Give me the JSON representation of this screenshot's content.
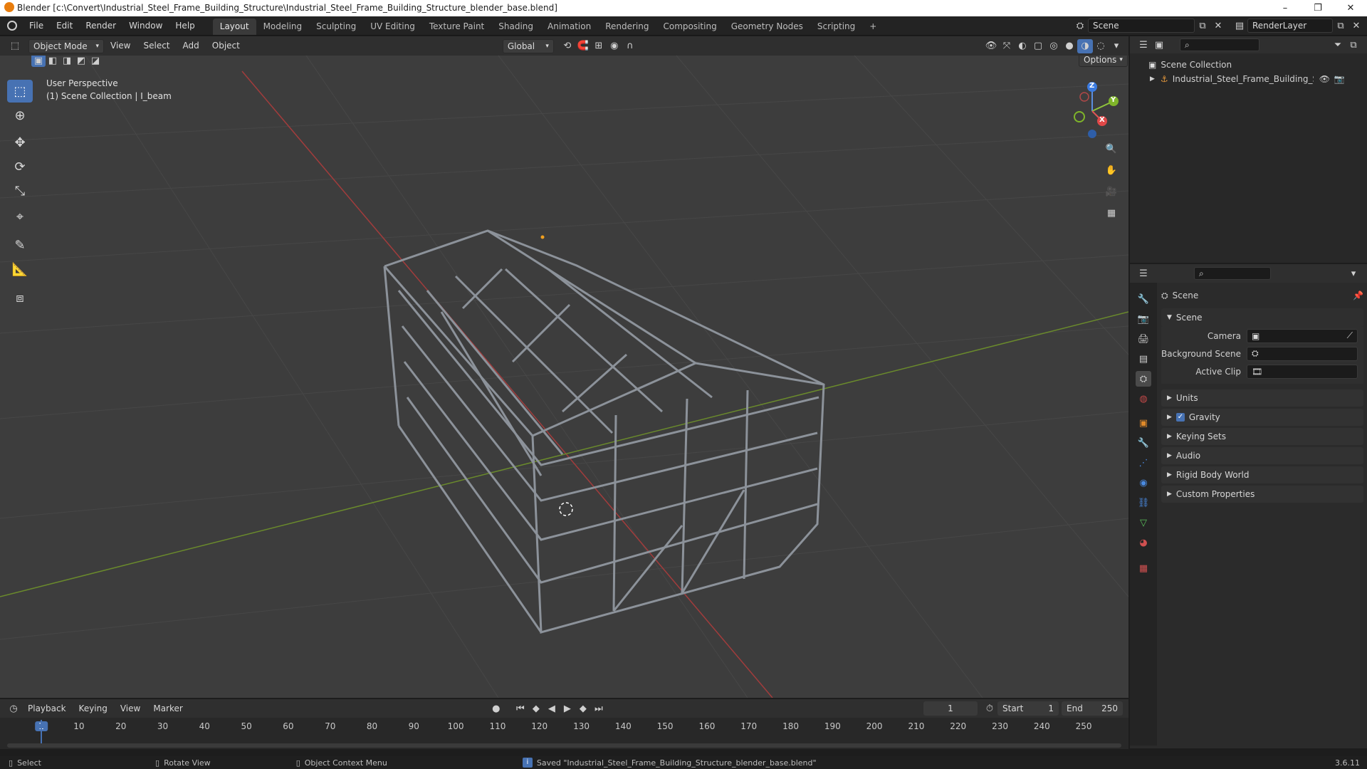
{
  "window": {
    "title": "Blender [c:\\Convert\\Industrial_Steel_Frame_Building_Structure\\Industrial_Steel_Frame_Building_Structure_blender_base.blend]",
    "minimize": "–",
    "maximize": "❐",
    "close": "✕"
  },
  "menubar": {
    "items": [
      "File",
      "Edit",
      "Render",
      "Window",
      "Help"
    ],
    "workspaces": [
      "Layout",
      "Modeling",
      "Sculpting",
      "UV Editing",
      "Texture Paint",
      "Shading",
      "Animation",
      "Rendering",
      "Compositing",
      "Geometry Nodes",
      "Scripting",
      "+"
    ],
    "active_workspace": "Layout",
    "scene_name": "Scene",
    "view_layer": "RenderLayer"
  },
  "viewport_header": {
    "mode": "Object Mode",
    "menus": [
      "View",
      "Select",
      "Add",
      "Object"
    ],
    "transform_orientation": "Global",
    "options_label": "Options"
  },
  "viewport": {
    "perspective_label": "User Perspective",
    "collection_label": "(1) Scene Collection | I_beam",
    "gizmo_axes": [
      "Z",
      "Y",
      "X"
    ]
  },
  "toolbar": {
    "tools": [
      "select-box",
      "cursor",
      "move",
      "rotate",
      "scale",
      "transform",
      "annotate",
      "measure",
      "add-cube"
    ],
    "active": "select-box"
  },
  "outliner": {
    "root": "Scene Collection",
    "items": [
      {
        "name": "Industrial_Steel_Frame_Building_Structu"
      }
    ]
  },
  "properties": {
    "context_title": "Scene",
    "panel_scene": "Scene",
    "fields": [
      {
        "label": "Camera",
        "value": ""
      },
      {
        "label": "Background Scene",
        "value": ""
      },
      {
        "label": "Active Clip",
        "value": ""
      }
    ],
    "panels": [
      "Units",
      "Gravity",
      "Keying Sets",
      "Audio",
      "Rigid Body World",
      "Custom Properties"
    ],
    "gravity_checked": true
  },
  "timeline": {
    "menus": [
      "Playback",
      "Keying",
      "View",
      "Marker"
    ],
    "current_frame": "1",
    "start_label": "Start",
    "start": "1",
    "end_label": "End",
    "end": "250",
    "ticks": [
      "1",
      "10",
      "20",
      "30",
      "40",
      "50",
      "60",
      "70",
      "80",
      "90",
      "100",
      "110",
      "120",
      "130",
      "140",
      "150",
      "160",
      "170",
      "180",
      "190",
      "200",
      "210",
      "220",
      "230",
      "240",
      "250"
    ]
  },
  "statusbar": {
    "select": "Select",
    "rotate": "Rotate View",
    "context": "Object Context Menu",
    "message": "Saved \"Industrial_Steel_Frame_Building_Structure_blender_base.blend\"",
    "version": "3.6.11"
  }
}
